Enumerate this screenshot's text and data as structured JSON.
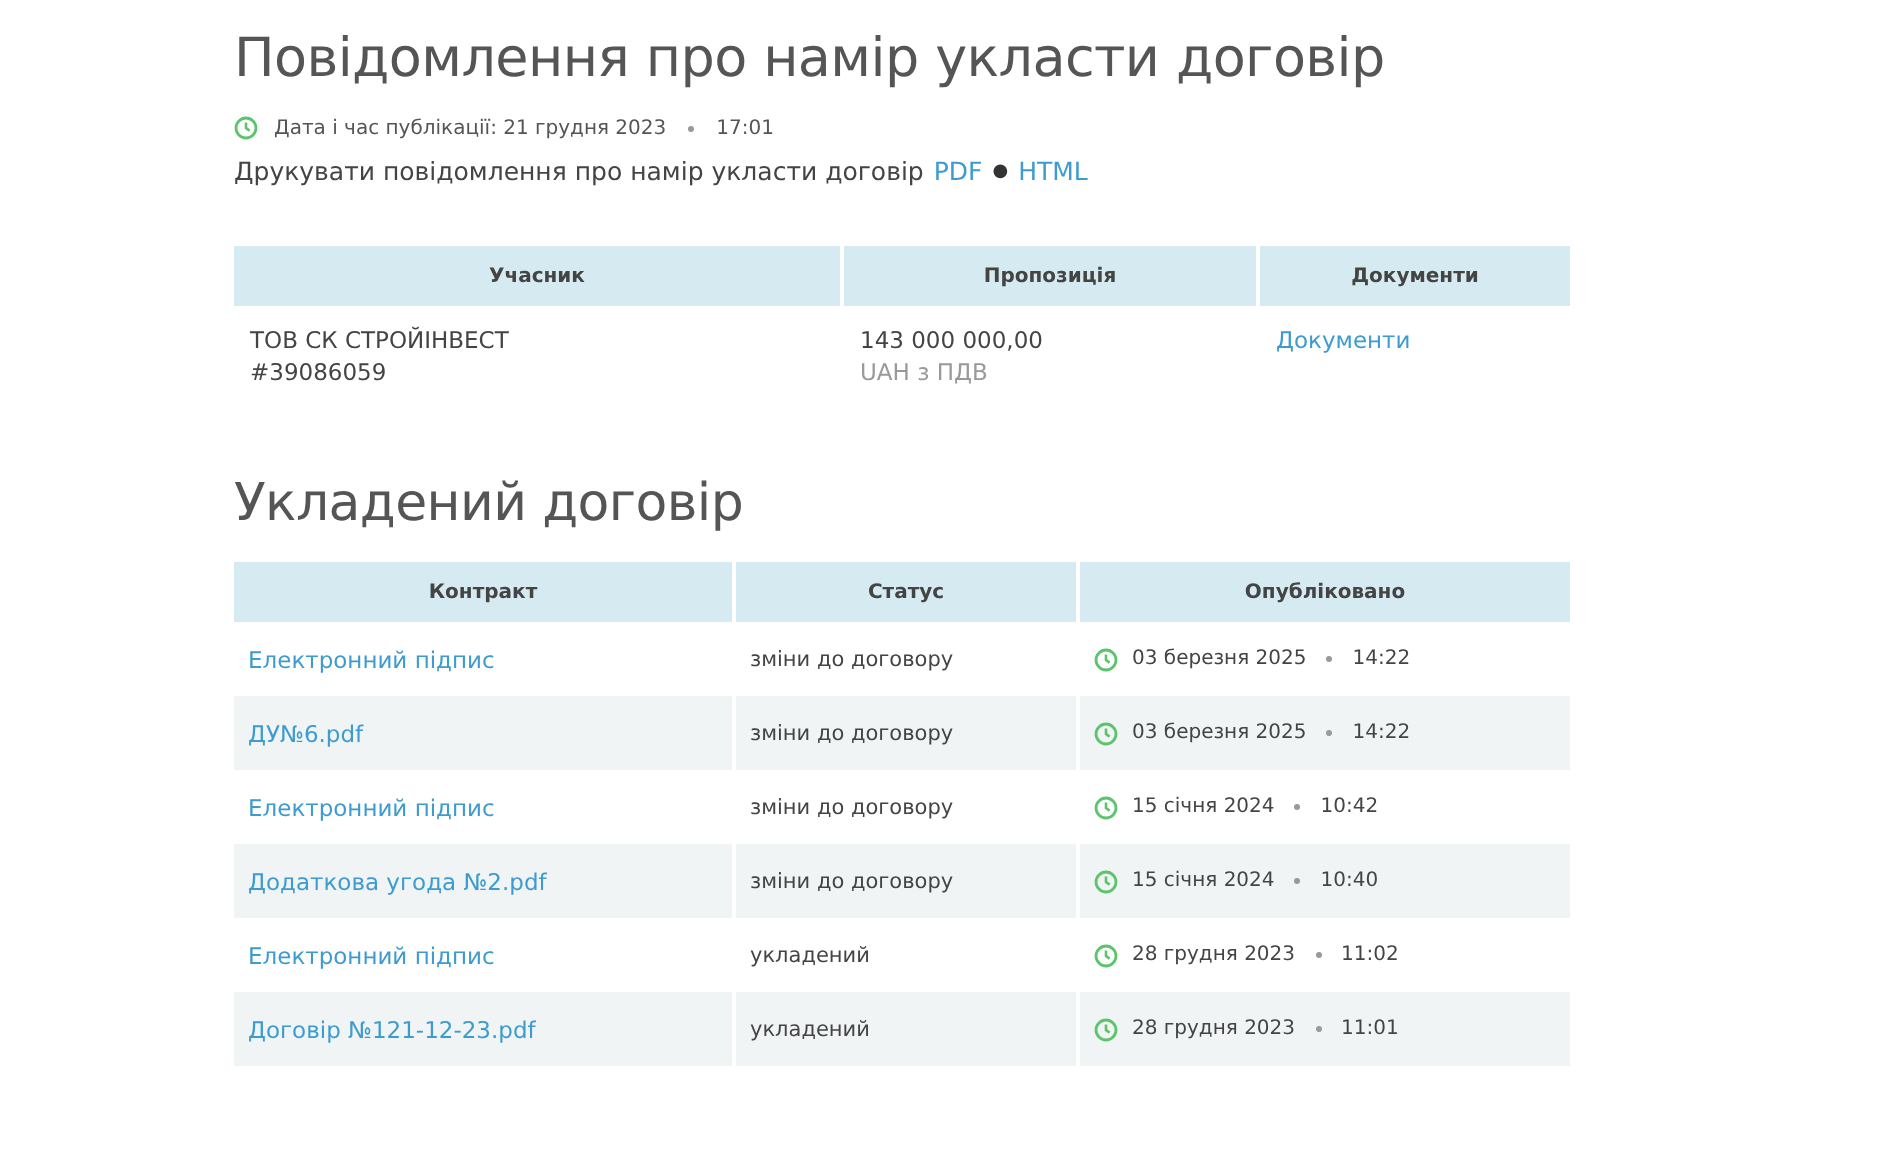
{
  "notice": {
    "title": "Повідомлення про намір укласти договір",
    "published_label": "Дата і час публікації: 21 грудня 2023",
    "published_time": "17:01",
    "print_text": "Друкувати повідомлення про намір укласти договір",
    "print_links": [
      "PDF",
      "HTML"
    ],
    "link_separator": "●"
  },
  "bids_table": {
    "columns": [
      "Учасник",
      "Пропозиція",
      "Документи"
    ],
    "rows": [
      {
        "participant": "ТОВ СК СТРОЙІНВЕСТ",
        "participant_id": "#39086059",
        "amount": "143 000 000,00",
        "currency": "UAH з ПДВ",
        "documents": "Документи"
      }
    ]
  },
  "contract": {
    "title": "Укладений договір",
    "columns": [
      "Контракт",
      "Статус",
      "Опубліковано"
    ],
    "rows": [
      {
        "file": "Електронний підпис",
        "status": "зміни до договору",
        "date": "03 березня 2025",
        "time": "14:22"
      },
      {
        "file": "ДУ№6.pdf",
        "status": "зміни до договору",
        "date": "03 березня 2025",
        "time": "14:22"
      },
      {
        "file": "Електронний підпис",
        "status": "зміни до договору",
        "date": "15 січня 2024",
        "time": "10:42"
      },
      {
        "file": "Додаткова угода №2.pdf",
        "status": "зміни до договору",
        "date": "15 січня 2024",
        "time": "10:40"
      },
      {
        "file": "Електронний підпис",
        "status": "укладений",
        "date": "28 грудня 2023",
        "time": "11:02"
      },
      {
        "file": "Договір №121-12-23.pdf",
        "status": "укладений",
        "date": "28 грудня 2023",
        "time": "11:01"
      }
    ]
  }
}
